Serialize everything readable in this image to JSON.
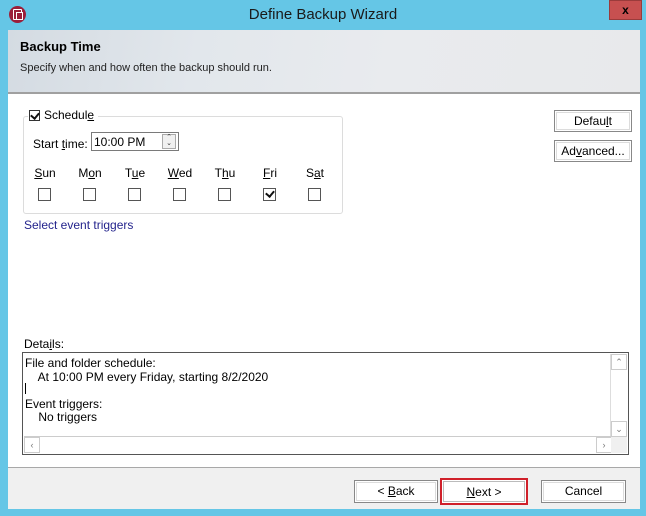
{
  "window": {
    "title": "Define Backup Wizard",
    "close_label": "x",
    "app_icon": "backup-app-icon"
  },
  "header": {
    "title": "Backup Time",
    "subtitle": "Specify when and how often the backup should run."
  },
  "schedule": {
    "label_pre": "Schedul",
    "label_access": "e",
    "checked": true,
    "start_time_label_pre": "Start ",
    "start_time_label_access": "t",
    "start_time_label_post": "ime:",
    "start_time_value": "10:00 PM",
    "days": [
      {
        "pre": "",
        "acc": "S",
        "post": "un",
        "checked": false
      },
      {
        "pre": "M",
        "acc": "o",
        "post": "n",
        "checked": false
      },
      {
        "pre": "T",
        "acc": "u",
        "post": "e",
        "checked": false
      },
      {
        "pre": "",
        "acc": "W",
        "post": "ed",
        "checked": false
      },
      {
        "pre": "T",
        "acc": "h",
        "post": "u",
        "checked": false
      },
      {
        "pre": "",
        "acc": "F",
        "post": "ri",
        "checked": true
      },
      {
        "pre": "S",
        "acc": "a",
        "post": "t",
        "checked": false
      }
    ]
  },
  "event_triggers_link": "Select event triggers",
  "side_buttons": {
    "default_pre": "Defau",
    "default_acc": "l",
    "default_post": "t",
    "advanced_pre": "Ad",
    "advanced_acc": "v",
    "advanced_post": "anced..."
  },
  "details": {
    "label_pre": "Deta",
    "label_acc": "i",
    "label_post": "ls:",
    "text": "File and folder schedule:\n    At 10:00 PM every Friday, starting 8/2/2020\n\nEvent triggers:\n    No triggers"
  },
  "footer": {
    "back_pre": "< ",
    "back_acc": "B",
    "back_post": "ack",
    "next_pre": "",
    "next_acc": "N",
    "next_post": "ext >",
    "cancel": "Cancel",
    "highlight_color": "#d0202a"
  }
}
